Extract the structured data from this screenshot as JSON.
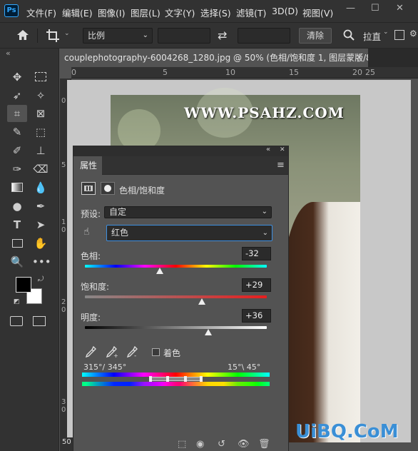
{
  "app": {
    "logo": "Ps"
  },
  "menus": [
    "文件(F)",
    "编辑(E)",
    "图像(I)",
    "图层(L)",
    "文字(Y)",
    "选择(S)",
    "滤镜(T)",
    "3D(D)",
    "视图(V)"
  ],
  "window_buttons": {
    "minimize": "—",
    "maximize": "☐",
    "close": "✕"
  },
  "options": {
    "ratio_label": "比例",
    "swap_icon": "⇄",
    "clear_label": "清除",
    "straighten_label": "拉直"
  },
  "toolbar_collapse": "«",
  "tab": {
    "title": "couplephotography-6004268_1280.jpg @ 50% (色相/饱和度 1, 图层蒙版/8) *",
    "close": "×"
  },
  "ruler_h": [
    "0",
    "5",
    "10",
    "15",
    "20",
    "25"
  ],
  "ruler_v": [
    "0",
    "5",
    "1 0",
    "1 5",
    "2 0",
    "2 5",
    "3 0"
  ],
  "zoom": "50",
  "canvas": {
    "watermark": "WWW.PSAHZ.COM",
    "site_badge": "UiBQ.CoM"
  },
  "panel": {
    "tab": "属性",
    "collapse": "«",
    "close": "✕",
    "menu_icon": "≡",
    "adjustment_title": "色相/饱和度",
    "preset_label": "预设:",
    "preset_value": "自定",
    "channel_value": "红色",
    "hue": {
      "label": "色相:",
      "value": "-32",
      "fraction": 0.41
    },
    "saturation": {
      "label": "饱和度:",
      "value": "+29",
      "fraction": 0.645
    },
    "lightness": {
      "label": "明度:",
      "value": "+36",
      "fraction": 0.68
    },
    "colorize_label": "着色",
    "range_left": "315°/ 345°",
    "range_right": "15°\\ 45°",
    "colors": {
      "hue_thumb": "#eeeeee"
    }
  }
}
